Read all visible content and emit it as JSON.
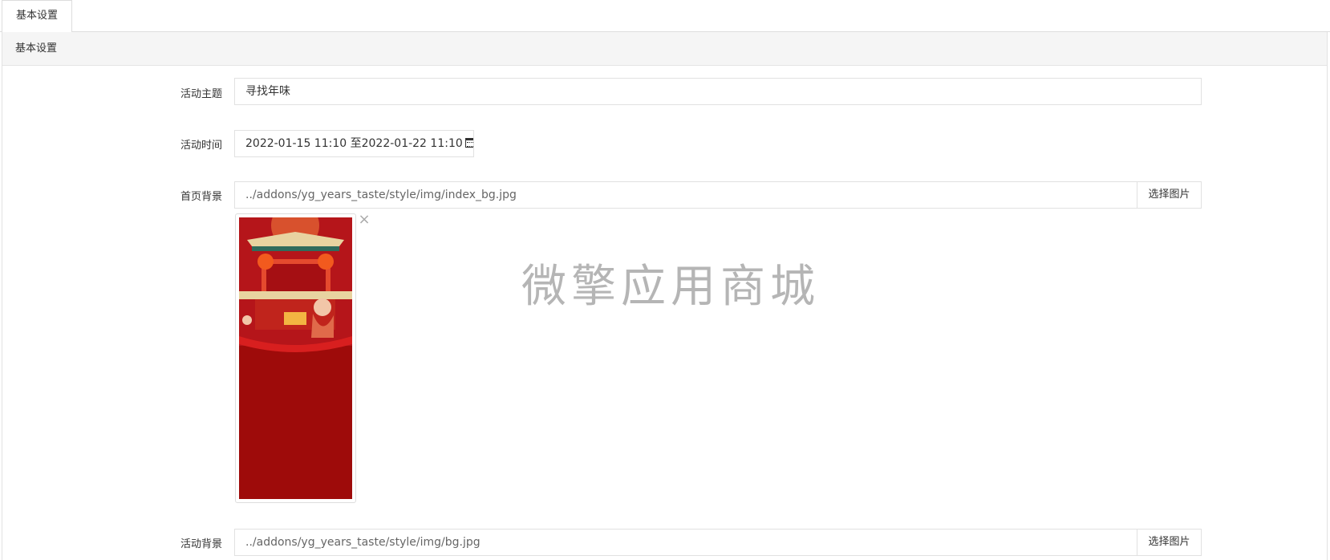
{
  "tabs": [
    {
      "label": "基本设置"
    }
  ],
  "panel": {
    "heading": "基本设置"
  },
  "form": {
    "theme": {
      "label": "活动主题",
      "value": "寻找年味"
    },
    "time": {
      "label": "活动时间",
      "value": "2022-01-15 11:10 至2022-01-22 11:10",
      "icon": "calendar-icon"
    },
    "home_bg": {
      "label": "首页背景",
      "value": "../addons/yg_years_taste/style/img/index_bg.jpg",
      "button": "选择图片"
    },
    "activity_bg": {
      "label": "活动背景",
      "value": "../addons/yg_years_taste/style/img/bg.jpg",
      "button": "选择图片"
    }
  },
  "thumbnail": {
    "close_symbol": "×"
  },
  "watermark": "微擎应用商城",
  "colors": {
    "festive_red": "#9e0b0a",
    "border": "#e1e1e1",
    "heading_bg": "#f5f5f5"
  }
}
